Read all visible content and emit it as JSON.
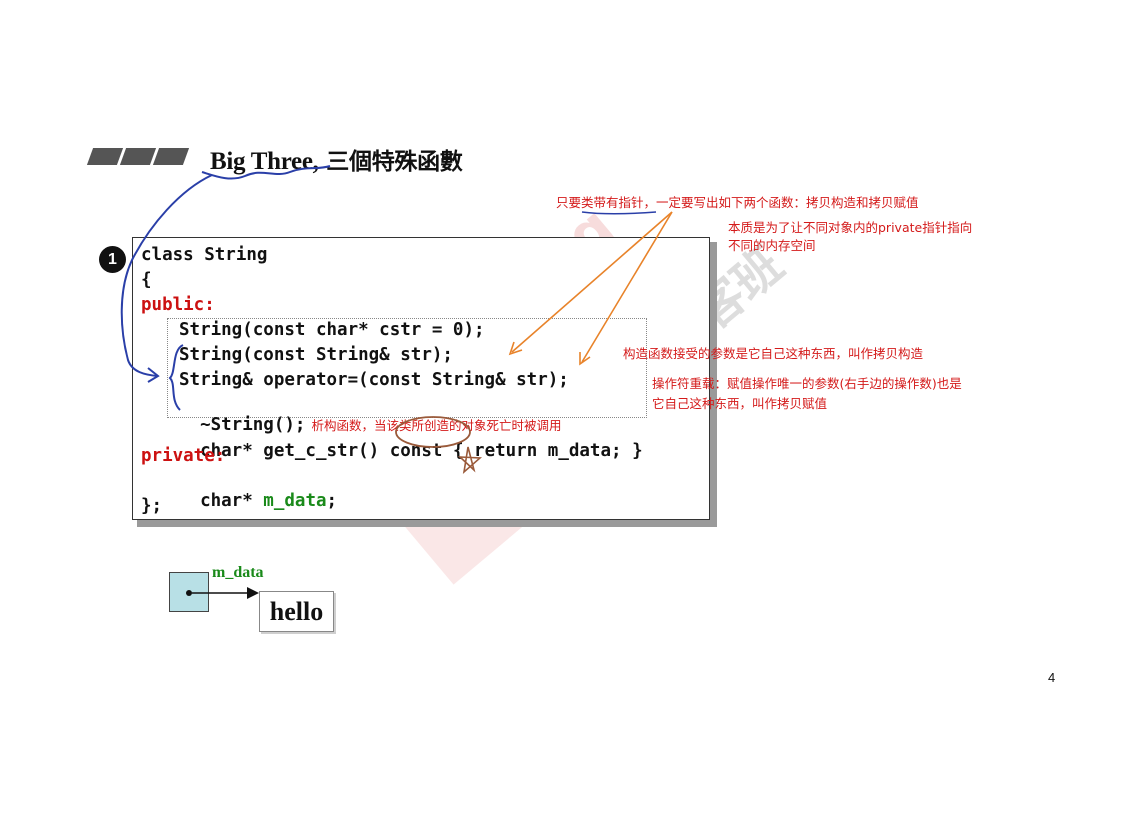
{
  "title": {
    "en": "Big Three,",
    "zh": " 三個特殊函數"
  },
  "badge": "1",
  "code": {
    "line1": "class String",
    "line2": "{",
    "line3": "public:",
    "line4": "String(const char* cstr = 0);",
    "line5": "String(const String& str);",
    "line6": "String& operator=(const String& str);",
    "line7": "~String();",
    "line8_prefix": "char* get_c_str() ",
    "line8_const": "const",
    "line8_suffix": " { return m_data; }",
    "line9": "private:",
    "line10_type": "char* ",
    "line10_member": "m_data",
    "line10_end": ";",
    "line11": "};"
  },
  "notes": {
    "top": "只要类带有指针，一定要写出如下两个函数：拷贝构造和拷贝赋值",
    "purpose_line1": "本质是为了让不同对象内的private指针指向",
    "purpose_line2": "不同的内存空间",
    "copy_ctor": "构造函数接受的参数是它自己这种东西，叫作拷贝构造",
    "copy_assign_line1": "操作符重载：赋值操作唯一的参数(右手边的操作数)也是",
    "copy_assign_line2": "它自己这种东西，叫作拷贝赋值",
    "destructor": "析构函数，当该类所创造的对象死亡时被调用"
  },
  "diagram": {
    "pointer_label": "m_data",
    "string_value": "hello"
  },
  "watermark": {
    "text": "GeekBang",
    "zh": "极客班"
  },
  "page_number": "4",
  "colors": {
    "keyword_red": "#cc1111",
    "member_green": "#1a8a1a",
    "annotation_red": "#d41a1a",
    "arrow_orange": "#e8832a",
    "pen_blue": "#2a3fa8",
    "pen_brown": "#9a5a3a",
    "pointer_box": "#b8e0e6"
  }
}
